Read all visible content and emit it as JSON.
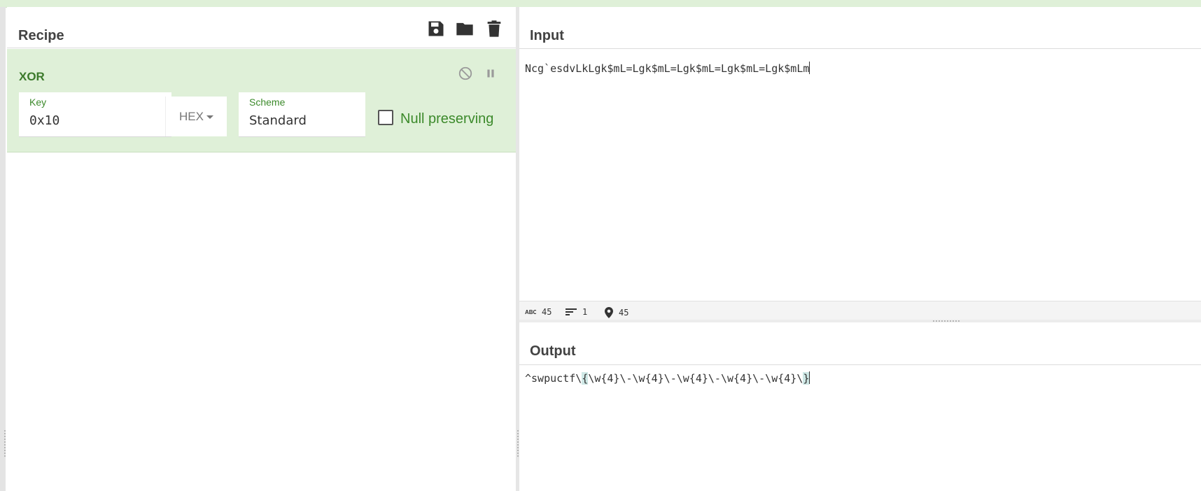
{
  "recipe": {
    "title": "Recipe",
    "icons": [
      "save-icon",
      "folder-icon",
      "trash-icon"
    ],
    "operation": {
      "name": "XOR",
      "icons": [
        "disable-icon",
        "pause-icon"
      ],
      "key": {
        "label": "Key",
        "value": "0x10",
        "format": "HEX"
      },
      "scheme": {
        "label": "Scheme",
        "value": "Standard"
      },
      "null_preserving": {
        "label": "Null preserving",
        "checked": false
      }
    }
  },
  "input": {
    "title": "Input",
    "text": "Ncg`esdvLkLgk$mL=Lgk$mL=Lgk$mL=Lgk$mL=Lgk$mLm",
    "status": {
      "chars": "45",
      "lines": "1",
      "position": "45"
    }
  },
  "output": {
    "title": "Output",
    "text_before": "^swpuctf\\",
    "text_open": "{",
    "text_middle": "\\w{4}\\-\\w{4}\\-\\w{4}\\-\\w{4}\\-\\w{4}\\",
    "text_close": "}"
  },
  "colors": {
    "accent": "#3c8a2b",
    "operation_bg": "#dff0d8",
    "highlight": "#cfe8e6"
  }
}
